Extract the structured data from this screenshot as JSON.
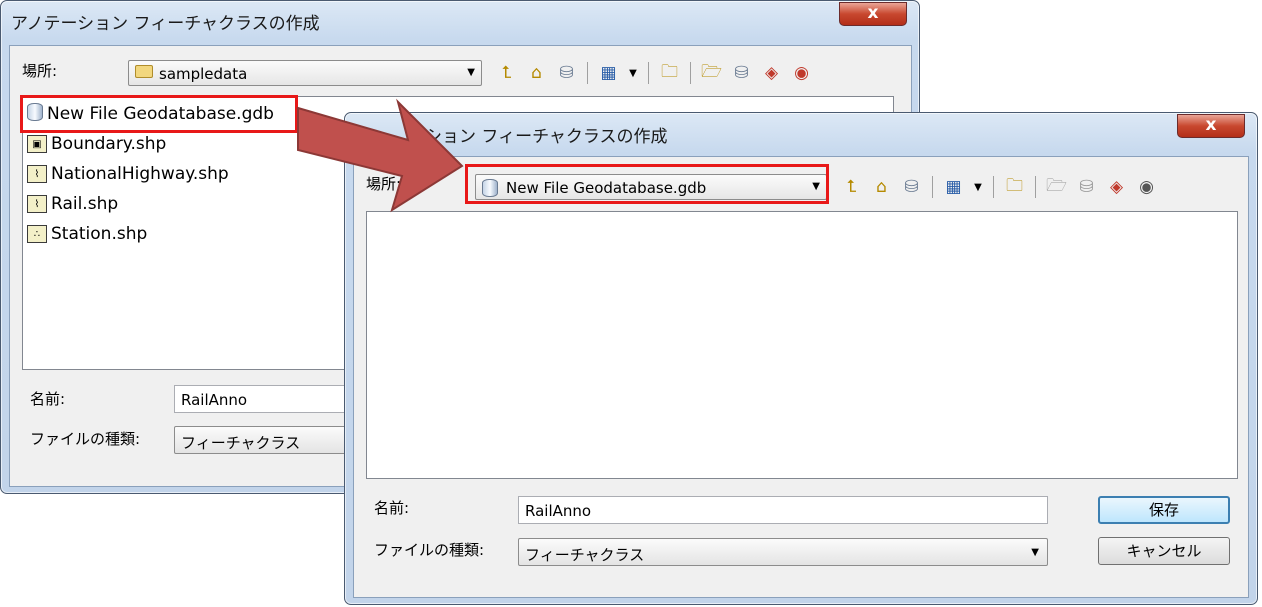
{
  "dialog_back": {
    "title": "アノテーション フィーチャクラスの作成",
    "close_label": "x",
    "location_label": "場所:",
    "location_value": "sampledata",
    "items": [
      {
        "label": "New File Geodatabase.gdb",
        "icon": "geodatabase-icon"
      },
      {
        "label": "Boundary.shp",
        "icon": "polygon-shapefile-icon"
      },
      {
        "label": "NationalHighway.shp",
        "icon": "line-shapefile-icon"
      },
      {
        "label": "Rail.shp",
        "icon": "line-shapefile-icon"
      },
      {
        "label": "Station.shp",
        "icon": "point-shapefile-icon"
      }
    ],
    "name_label": "名前:",
    "name_value": "RailAnno",
    "type_label": "ファイルの種類:",
    "type_value": "フィーチャクラス"
  },
  "dialog_front": {
    "title": "ション フィーチャクラスの作成",
    "close_label": "x",
    "location_label": "場所:",
    "location_value": "New File Geodatabase.gdb",
    "name_label": "名前:",
    "name_value": "RailAnno",
    "type_label": "ファイルの種類:",
    "type_value": "フィーチャクラス",
    "save_label": "保存",
    "cancel_label": "キャンセル"
  },
  "colors": {
    "highlight": "#e81818",
    "arrow": "#c0504d"
  }
}
